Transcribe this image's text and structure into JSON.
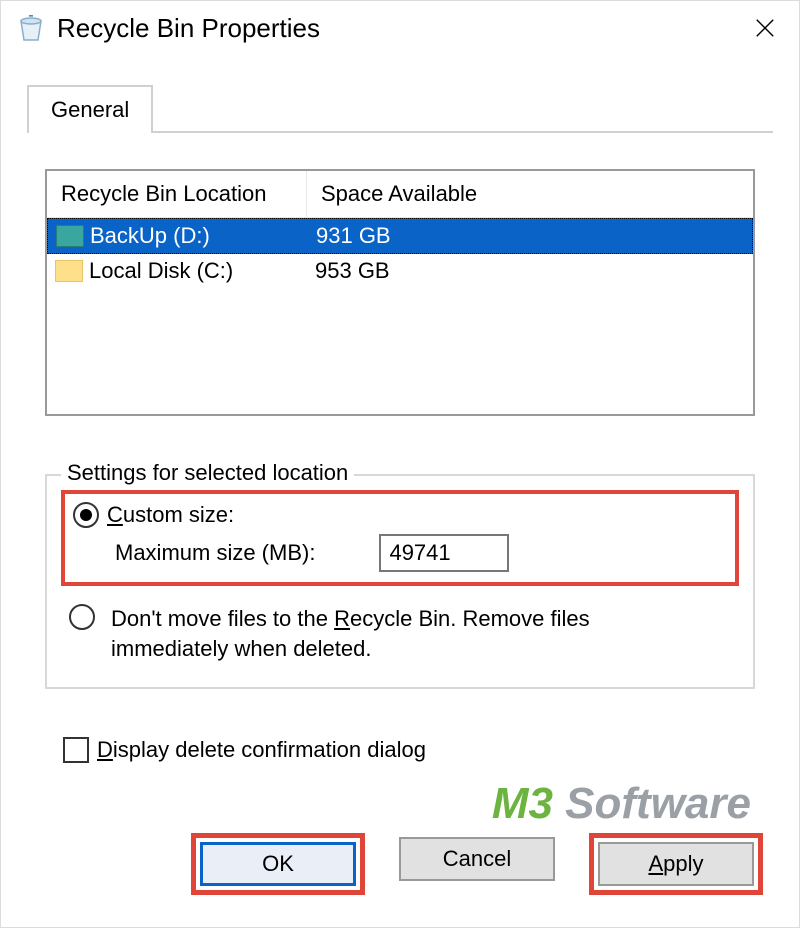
{
  "window": {
    "title": "Recycle Bin Properties"
  },
  "tabs": {
    "general": "General"
  },
  "list": {
    "col_location": "Recycle Bin Location",
    "col_space": "Space Available",
    "rows": [
      {
        "loc": "BackUp (D:)",
        "space": "931 GB",
        "selected": true
      },
      {
        "loc": "Local Disk (C:)",
        "space": "953 GB",
        "selected": false
      }
    ]
  },
  "settings": {
    "legend": "Settings for selected location",
    "custom_size_label_pre": "C",
    "custom_size_label_rest": "ustom size:",
    "max_size_label": "Maximum size (MB):",
    "max_size_value": "49741",
    "dont_move_pre": "Don't move files to the ",
    "dont_move_u": "R",
    "dont_move_rest": "ecycle Bin. Remove files immediately when deleted.",
    "confirm_pre": "D",
    "confirm_rest": "isplay delete confirmation dialog"
  },
  "buttons": {
    "ok": "OK",
    "cancel": "Cancel",
    "apply_u": "A",
    "apply_rest": "pply"
  },
  "watermark": {
    "m3": "M3 ",
    "sw": "Software"
  }
}
